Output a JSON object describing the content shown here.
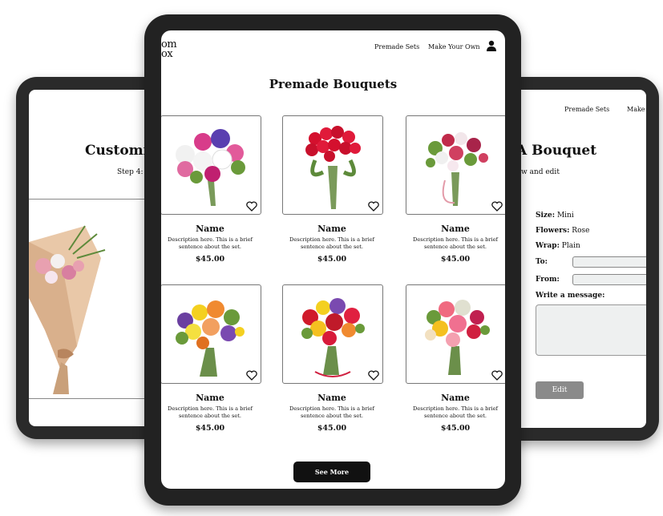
{
  "left_screen": {
    "title": "Customiz",
    "step": "Step 4: R"
  },
  "right_screen": {
    "nav": [
      "Premade Sets",
      "Make"
    ],
    "title": "A Bouquet",
    "subtitle": "w and edit",
    "fields": [
      {
        "label": "Size:",
        "value": "Mini"
      },
      {
        "label": "Flowers:",
        "value": "Rose"
      },
      {
        "label": "Wrap:",
        "value": "Plain"
      }
    ],
    "to_label": "To:",
    "from_label": "From:",
    "message_label": "Write a message:",
    "edit_button": "Edit"
  },
  "center_screen": {
    "logo": [
      "om",
      "ox"
    ],
    "nav": [
      "Premade Sets",
      "Make Your Own"
    ],
    "title": "Premade Bouquets",
    "products": [
      {
        "name": "Name",
        "description": "Description here. This is a brief sentence about the set.",
        "price": "$45.00"
      },
      {
        "name": "Name",
        "description": "Description here. This is a brief sentence about the set.",
        "price": "$45.00"
      },
      {
        "name": "Name",
        "description": "Description here. This is a brief sentence about the set.",
        "price": "$45.00"
      },
      {
        "name": "Name",
        "description": "Description here. This is a brief sentence about the set.",
        "price": "$45.00"
      },
      {
        "name": "Name",
        "description": "Description here. This is a brief sentence about the set.",
        "price": "$45.00"
      },
      {
        "name": "Name",
        "description": "Description here. This is a brief sentence about the set.",
        "price": "$45.00"
      }
    ],
    "see_more": "See More"
  },
  "icons": [
    "user-icon",
    "heart-icon"
  ],
  "colors": {
    "frame": "#222222",
    "button": "#111111",
    "edit_button": "#8a8a8a",
    "field_bg": "#eef0f0"
  }
}
